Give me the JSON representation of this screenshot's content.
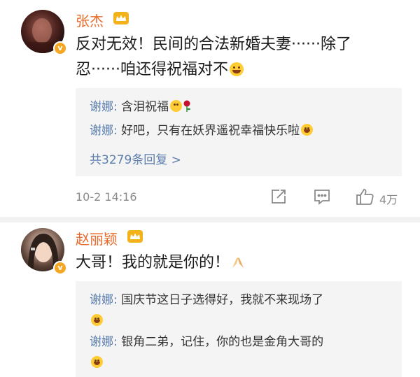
{
  "comments": [
    {
      "username": "张杰",
      "text_line1": "反对无效！民间的合法新婚夫妻······除了",
      "text_line2": "忍······咱还得祝福对不",
      "replies": [
        {
          "author": "谢娜",
          "text": "含泪祝福"
        },
        {
          "author": "谢娜",
          "text": "好吧，只有在妖界遥祝幸福快乐啦"
        }
      ],
      "more_replies": "共3279条回复 >",
      "timestamp": "10-2 14:16",
      "like_count": "4万"
    },
    {
      "username": "赵丽颖",
      "text_line1": "大哥！我的就是你的！",
      "replies": [
        {
          "author": "谢娜",
          "text": "国庆节这日子选得好，我就不来现场了"
        },
        {
          "author": "谢娜",
          "text": "银角二弟，记住，你的也是金角大哥的"
        }
      ]
    }
  ],
  "icons": {
    "verified": "verified-v-icon",
    "vip": "crown-icon",
    "share": "share-icon",
    "reply": "comment-icon",
    "like": "thumbs-up-icon"
  },
  "colors": {
    "username": "#e86b2c",
    "reply_author": "#5b7fad",
    "vip_badge": "#f3b21a",
    "verified": "#f5a623"
  }
}
